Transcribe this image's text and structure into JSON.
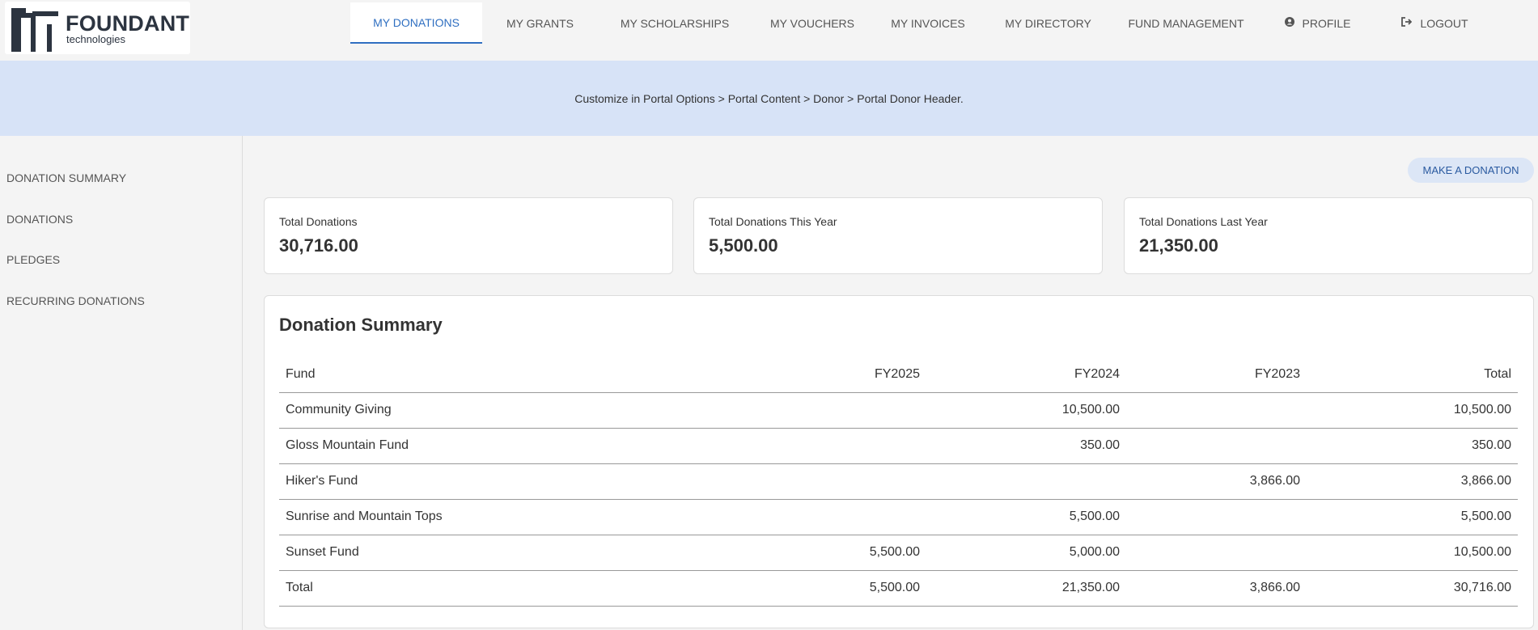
{
  "brand": {
    "logo_word": "FOUNDANT",
    "logo_sub": "technologies"
  },
  "nav": {
    "items": [
      {
        "label": "MY DONATIONS",
        "active": true
      },
      {
        "label": "MY GRANTS"
      },
      {
        "label": "MY SCHOLARSHIPS"
      },
      {
        "label": "MY VOUCHERS"
      },
      {
        "label": "MY INVOICES"
      },
      {
        "label": "MY DIRECTORY"
      },
      {
        "label": "FUND MANAGEMENT"
      },
      {
        "label": "PROFILE",
        "icon": "user-circle-icon"
      },
      {
        "label": "LOGOUT",
        "icon": "sign-out-icon"
      }
    ]
  },
  "banner": {
    "text": "Customize in Portal Options > Portal Content > Donor > Portal Donor Header."
  },
  "sidebar": {
    "items": [
      {
        "label": "DONATION SUMMARY"
      },
      {
        "label": "DONATIONS"
      },
      {
        "label": "PLEDGES"
      },
      {
        "label": "RECURRING DONATIONS"
      }
    ]
  },
  "actions": {
    "make_donation": "MAKE A DONATION"
  },
  "cards": [
    {
      "label": "Total Donations",
      "value": "30,716.00"
    },
    {
      "label": "Total Donations This Year",
      "value": "5,500.00"
    },
    {
      "label": "Total Donations Last Year",
      "value": "21,350.00"
    }
  ],
  "summary": {
    "title": "Donation Summary",
    "columns": [
      "Fund",
      "FY2025",
      "FY2024",
      "FY2023",
      "Total"
    ],
    "rows": [
      [
        "Community Giving",
        "",
        "10,500.00",
        "",
        "10,500.00"
      ],
      [
        "Gloss Mountain Fund",
        "",
        "350.00",
        "",
        "350.00"
      ],
      [
        "Hiker's Fund",
        "",
        "",
        "3,866.00",
        "3,866.00"
      ],
      [
        "Sunrise and Mountain Tops",
        "",
        "5,500.00",
        "",
        "5,500.00"
      ],
      [
        "Sunset Fund",
        "5,500.00",
        "5,000.00",
        "",
        "10,500.00"
      ],
      [
        "Total",
        "5,500.00",
        "21,350.00",
        "3,866.00",
        "30,716.00"
      ]
    ]
  },
  "colors": {
    "accent": "#2f6fc1",
    "banner_bg": "#d7e3f7",
    "button_bg": "#dce6f6",
    "page_bg": "#f4f4f4"
  }
}
